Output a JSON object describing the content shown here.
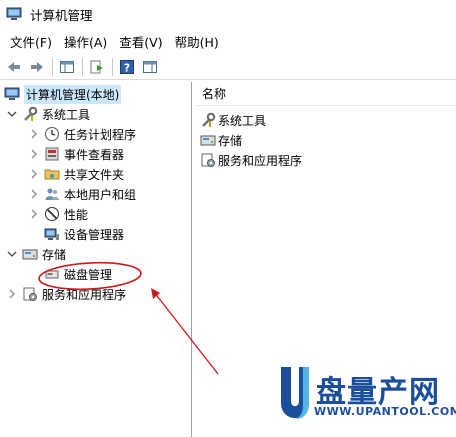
{
  "window": {
    "title": "计算机管理"
  },
  "menu": [
    "文件(F)",
    "操作(A)",
    "查看(V)",
    "帮助(H)"
  ],
  "toolbar": {
    "buttons": [
      "back-icon",
      "forward-icon",
      "show-hide-tree-icon",
      "export-list-icon",
      "help-icon",
      "action-pane-icon"
    ]
  },
  "tree": {
    "root": "计算机管理(本地)",
    "system_tools": "系统工具",
    "task_scheduler": "任务计划程序",
    "event_viewer": "事件查看器",
    "shared_folders": "共享文件夹",
    "local_users": "本地用户和组",
    "performance": "性能",
    "device_manager": "设备管理器",
    "storage": "存储",
    "disk_management": "磁盘管理",
    "services_apps": "服务和应用程序"
  },
  "list": {
    "column_name": "名称",
    "items": [
      "系统工具",
      "存储",
      "服务和应用程序"
    ]
  },
  "watermark": {
    "big": "盘量产网",
    "url": "WWW.UPANTOOL.COM"
  },
  "colors": {
    "selection": "#cce8ff",
    "annotation": "#cc1a1a",
    "watermark": "#1b4f9c"
  }
}
